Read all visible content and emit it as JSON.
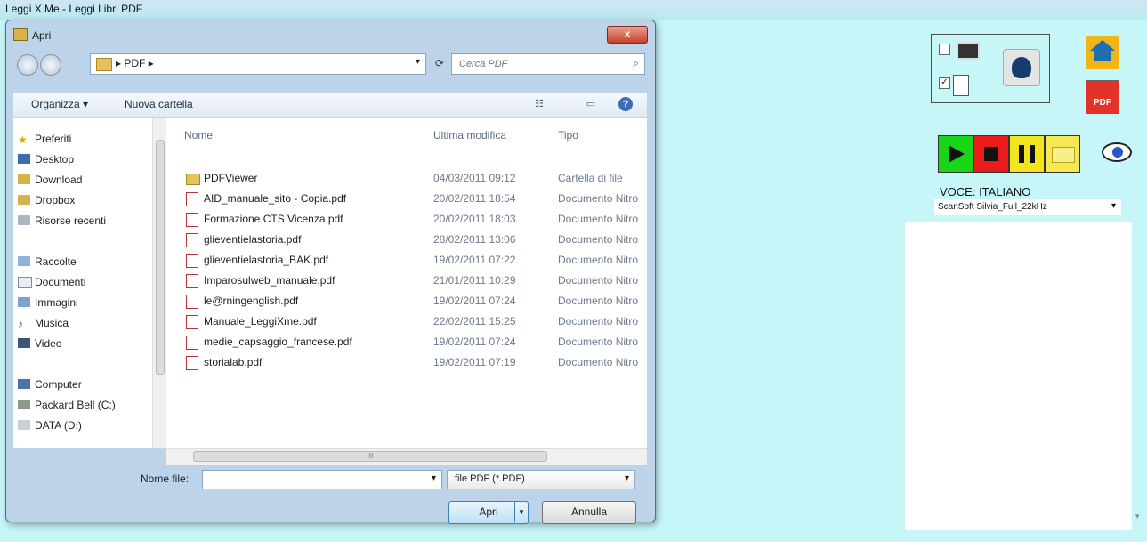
{
  "app": {
    "title": "Leggi X Me - Leggi Libri PDF"
  },
  "dialog": {
    "title": "Apri",
    "close_label": "x",
    "path": {
      "sep": "▸",
      "folder": "PDF",
      "dropdown": "▾"
    },
    "search_placeholder": "Cerca PDF",
    "toolbar": {
      "organize": "Organizza ▾",
      "new_folder": "Nuova cartella"
    },
    "sidebar": {
      "items": [
        {
          "label": "Preferiti",
          "icon": "star-icon"
        },
        {
          "label": "Desktop",
          "icon": "desktop-icon"
        },
        {
          "label": "Download",
          "icon": "download-icon"
        },
        {
          "label": "Dropbox",
          "icon": "dropbox-icon"
        },
        {
          "label": "Risorse recenti",
          "icon": "recent-icon"
        },
        {
          "label": "Raccolte",
          "icon": "library-icon"
        },
        {
          "label": "Documenti",
          "icon": "documents-icon"
        },
        {
          "label": "Immagini",
          "icon": "pictures-icon"
        },
        {
          "label": "Musica",
          "icon": "music-icon"
        },
        {
          "label": "Video",
          "icon": "video-icon"
        },
        {
          "label": "Computer",
          "icon": "computer-icon"
        },
        {
          "label": "Packard Bell (C:)",
          "icon": "drive-icon"
        },
        {
          "label": "DATA (D:)",
          "icon": "drive-icon"
        }
      ]
    },
    "columns": {
      "name": "Nome",
      "modified": "Ultima modifica",
      "type": "Tipo"
    },
    "files": [
      {
        "name": "PDFViewer",
        "date": "04/03/2011 09:12",
        "type": "Cartella di file",
        "folder": true
      },
      {
        "name": "AID_manuale_sito - Copia.pdf",
        "date": "20/02/2011 18:54",
        "type": "Documento Nitro"
      },
      {
        "name": "Formazione CTS Vicenza.pdf",
        "date": "20/02/2011 18:03",
        "type": "Documento Nitro"
      },
      {
        "name": "glieventielastoria.pdf",
        "date": "28/02/2011 13:06",
        "type": "Documento Nitro"
      },
      {
        "name": "glieventielastoria_BAK.pdf",
        "date": "19/02/2011 07:22",
        "type": "Documento Nitro"
      },
      {
        "name": "Imparosulweb_manuale.pdf",
        "date": "21/01/2011 10:29",
        "type": "Documento Nitro"
      },
      {
        "name": "le@rningenglish.pdf",
        "date": "19/02/2011 07:24",
        "type": "Documento Nitro"
      },
      {
        "name": "Manuale_LeggiXme.pdf",
        "date": "22/02/2011 15:25",
        "type": "Documento Nitro"
      },
      {
        "name": "medie_capsaggio_francese.pdf",
        "date": "19/02/2011 07:24",
        "type": "Documento Nitro"
      },
      {
        "name": "storialab.pdf",
        "date": "19/02/2011 07:19",
        "type": "Documento Nitro"
      }
    ],
    "bottom": {
      "filename_label": "Nome file:",
      "filename_value": "",
      "filetype": "file PDF (*.PDF)",
      "open": "Apri",
      "cancel": "Annulla"
    }
  },
  "right_panel": {
    "voice_label": "VOCE:  ITALIANO",
    "voice_value": "ScanSoft Silvia_Full_22kHz",
    "pdf_icon_text": "PDF",
    "checkbox_doc": "✓"
  }
}
